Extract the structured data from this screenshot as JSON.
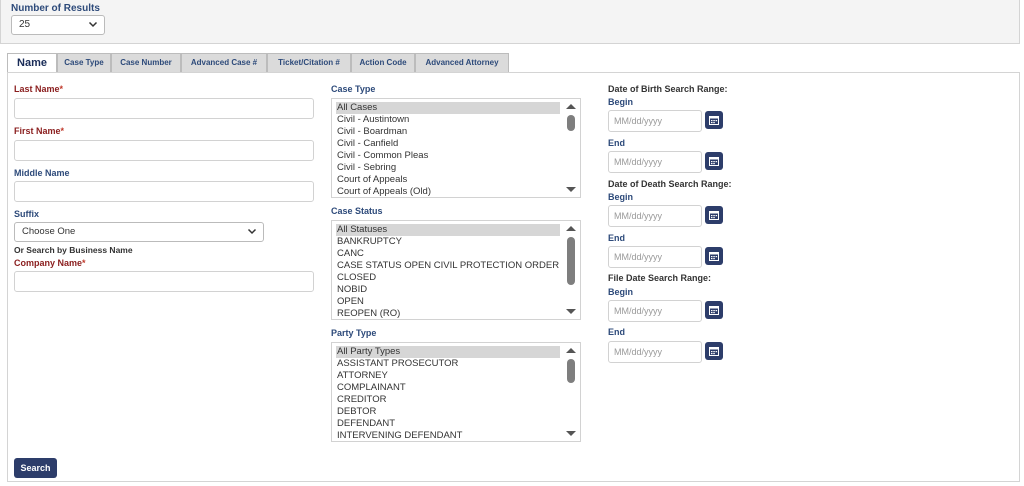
{
  "results": {
    "label": "Number of Results",
    "value": "25"
  },
  "tabs": [
    {
      "label": "Name"
    },
    {
      "label": "Case Type"
    },
    {
      "label": "Case Number"
    },
    {
      "label": "Advanced Case #"
    },
    {
      "label": "Ticket/Citation #"
    },
    {
      "label": "Action Code"
    },
    {
      "label": "Advanced Attorney"
    }
  ],
  "form": {
    "last_name": {
      "label": "Last Name",
      "required_mark": "*",
      "value": ""
    },
    "first_name": {
      "label": "First Name",
      "required_mark": "*",
      "value": ""
    },
    "middle_name": {
      "label": "Middle Name",
      "value": ""
    },
    "suffix": {
      "label": "Suffix",
      "value": "Choose One"
    },
    "business_hint": "Or Search by Business Name",
    "company_name": {
      "label": "Company Name",
      "required_mark": "*",
      "value": ""
    }
  },
  "case_type": {
    "label": "Case Type",
    "options": [
      "All Cases",
      "Civil - Austintown",
      "Civil - Boardman",
      "Civil - Canfield",
      "Civil - Common Pleas",
      "Civil - Sebring",
      "Court of Appeals",
      "Court of Appeals (Old)"
    ],
    "selected": "All Cases"
  },
  "case_status": {
    "label": "Case Status",
    "options": [
      "All Statuses",
      "BANKRUPTCY",
      "CANC",
      "CASE STATUS OPEN CIVIL PROTECTION ORDER",
      "CLOSED",
      "NOBID",
      "OPEN",
      "REOPEN (RO)"
    ],
    "selected": "All Statuses"
  },
  "party_type": {
    "label": "Party Type",
    "options": [
      "All Party Types",
      "ASSISTANT PROSECUTOR",
      "ATTORNEY",
      "COMPLAINANT",
      "CREDITOR",
      "DEBTOR",
      "DEFENDANT",
      "INTERVENING DEFENDANT"
    ],
    "selected": "All Party Types"
  },
  "dates": {
    "dob_label": "Date of Birth Search Range:",
    "dod_label": "Date of Death Search Range:",
    "file_label": "File Date Search Range:",
    "begin_label": "Begin",
    "end_label": "End",
    "placeholder": "MM/dd/yyyy"
  },
  "search_label": "Search",
  "colors": {
    "accent": "#2d3d6a",
    "label": "#2d4a7a",
    "required_label": "#8a1d1d"
  }
}
